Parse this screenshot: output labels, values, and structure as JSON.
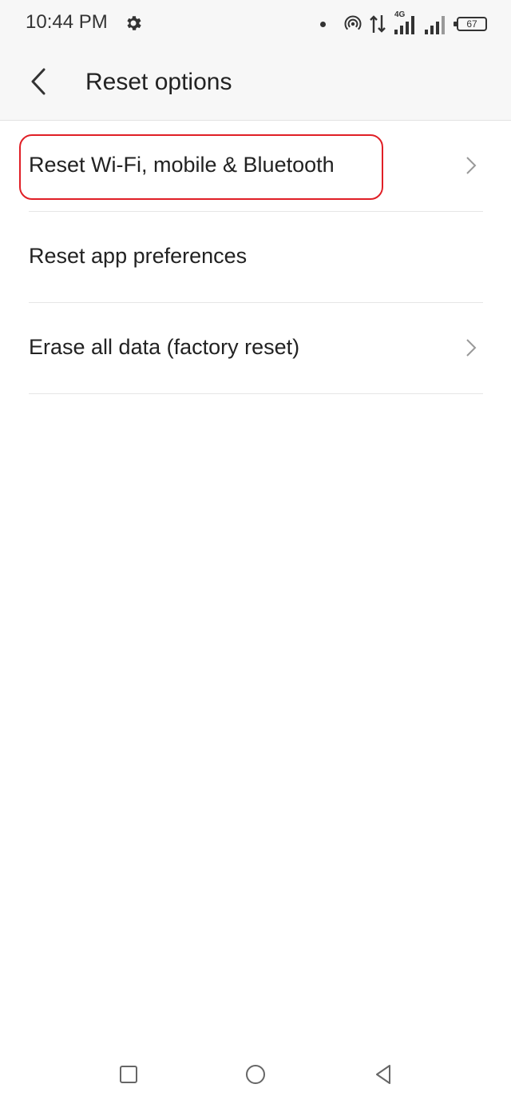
{
  "status_bar": {
    "time": "10:44 PM",
    "network_type": "4G",
    "battery_level": "67",
    "icons": [
      "settings-gear-icon",
      "notification-dot-icon",
      "hotspot-icon",
      "data-transfer-icon",
      "signal-4g-icon",
      "signal-icon",
      "battery-icon"
    ]
  },
  "app_bar": {
    "title": "Reset options",
    "back_icon": "chevron-left-icon"
  },
  "list": {
    "items": [
      {
        "label": "Reset Wi-Fi, mobile & Bluetooth",
        "has_chevron": true,
        "highlighted": true
      },
      {
        "label": "Reset app preferences",
        "has_chevron": false,
        "highlighted": false
      },
      {
        "label": "Erase all data (factory reset)",
        "has_chevron": true,
        "highlighted": false
      }
    ]
  },
  "highlight": {
    "color": "#e01f26"
  },
  "nav_bar": {
    "icons": [
      "recents-square-icon",
      "home-circle-icon",
      "back-triangle-icon"
    ]
  }
}
